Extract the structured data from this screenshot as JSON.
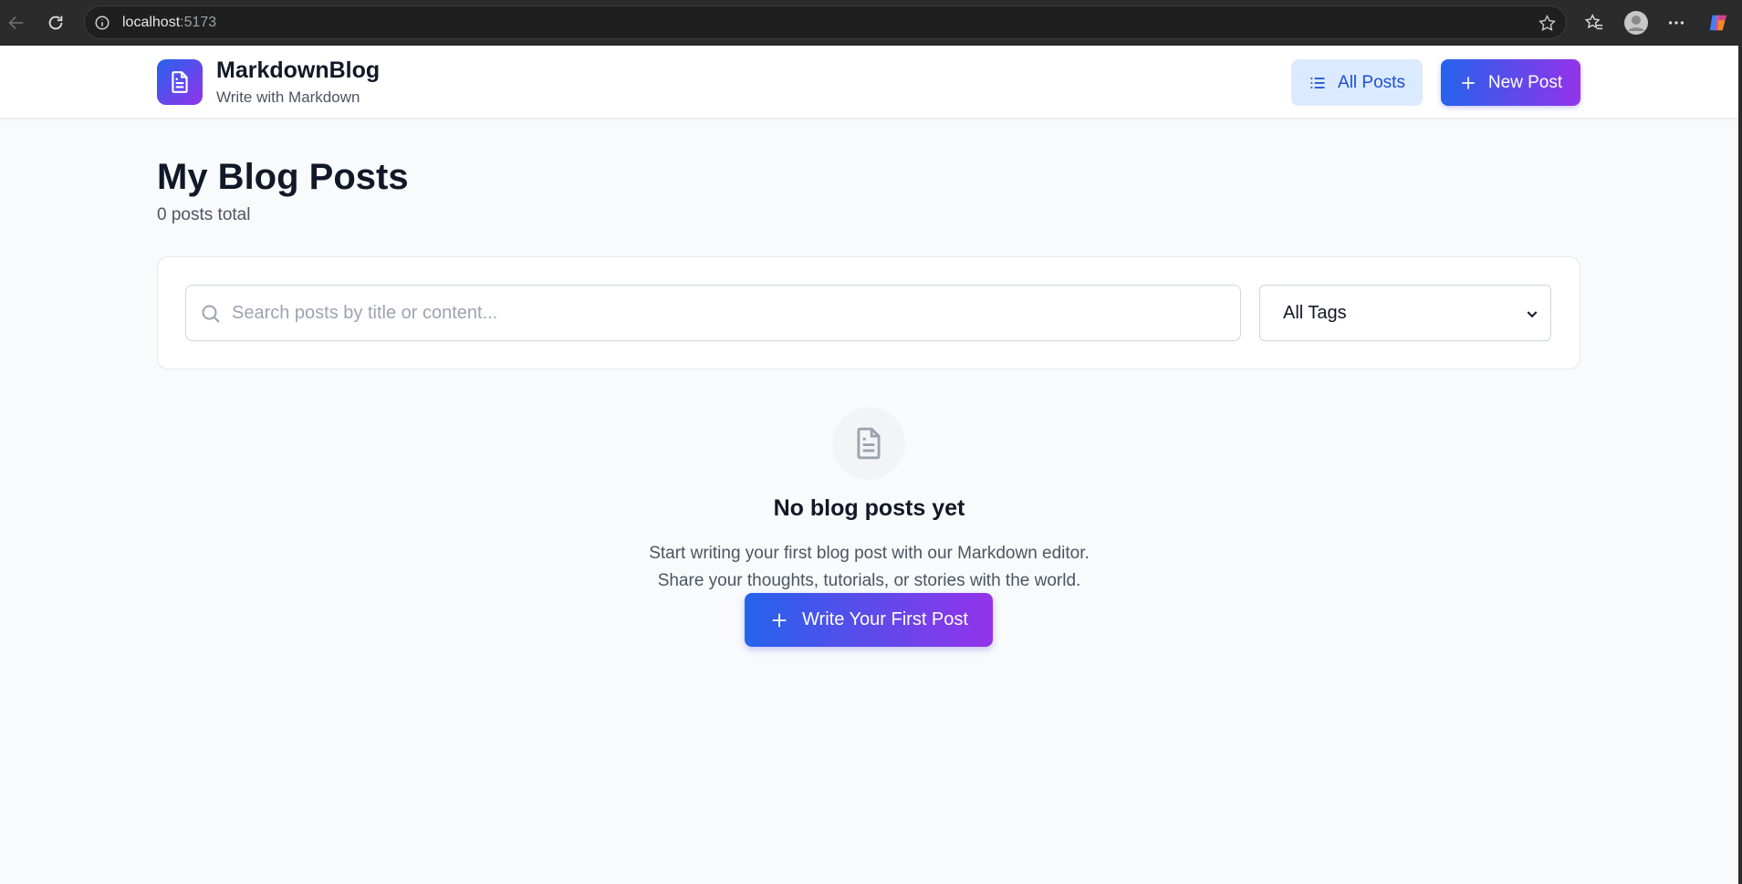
{
  "browser": {
    "url_host": "localhost",
    "url_port": ":5173",
    "icons": [
      "back-icon",
      "reload-icon",
      "site-info-icon",
      "star-icon",
      "favorites-icon",
      "profile-icon",
      "more-icon",
      "copilot-icon"
    ]
  },
  "header": {
    "brand_title": "MarkdownBlog",
    "brand_subtitle": "Write with Markdown",
    "all_posts_label": "All Posts",
    "new_post_label": "New Post"
  },
  "main": {
    "title": "My Blog Posts",
    "post_count": "0 posts total",
    "search_placeholder": "Search posts by title or content...",
    "search_value": "",
    "tag_filter_value": "All Tags"
  },
  "empty_state": {
    "title": "No blog posts yet",
    "line1": "Start writing your first blog post with our Markdown editor.",
    "line2": "Share your thoughts, tutorials, or stories with the world.",
    "cta_label": "Write Your First Post"
  },
  "colors": {
    "accent_start": "#2563eb",
    "accent_end": "#9333ea",
    "all_posts_bg": "#dbeafe",
    "page_bg": "#f9fafb"
  }
}
